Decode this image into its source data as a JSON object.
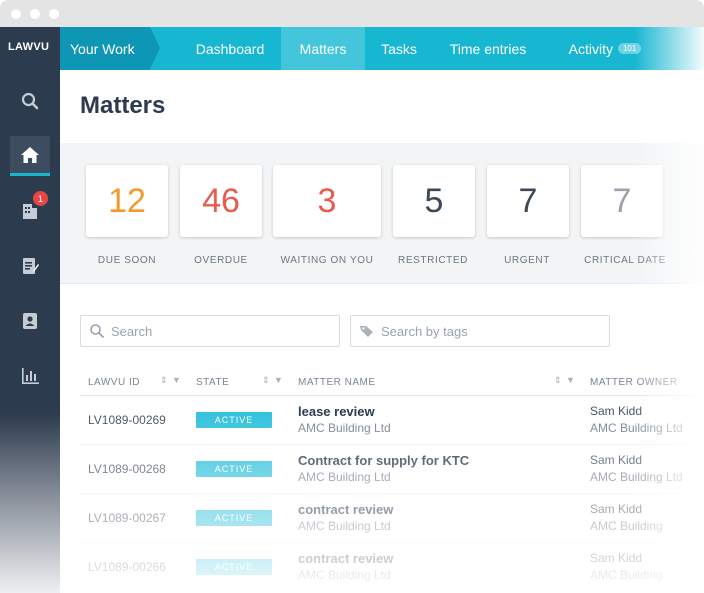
{
  "app": {
    "logo_text": "LAWVU"
  },
  "sidebar": {
    "items": [
      {
        "icon": "search-icon",
        "active": false
      },
      {
        "icon": "home-icon",
        "active": true
      },
      {
        "icon": "building-icon",
        "active": false,
        "badge": "1"
      },
      {
        "icon": "edit-document-icon",
        "active": false
      },
      {
        "icon": "contacts-icon",
        "active": false
      },
      {
        "icon": "bar-chart-icon",
        "active": false
      }
    ]
  },
  "nav": {
    "your_work": "Your Work",
    "tabs": [
      {
        "label": "Dashboard",
        "active": false
      },
      {
        "label": "Matters",
        "active": true
      },
      {
        "label": "Tasks",
        "active": false
      },
      {
        "label": "Time entries",
        "active": false
      },
      {
        "label": "Activity",
        "active": false,
        "count": "101"
      }
    ]
  },
  "page": {
    "title": "Matters"
  },
  "stats": [
    {
      "value": "12",
      "label": "DUE SOON",
      "color": "#f39a2b"
    },
    {
      "value": "46",
      "label": "OVERDUE",
      "color": "#e85b4d"
    },
    {
      "value": "3",
      "label": "WAITING ON YOU",
      "color": "#e85b4d"
    },
    {
      "value": "5",
      "label": "RESTRICTED",
      "color": "#3d4856"
    },
    {
      "value": "7",
      "label": "URGENT",
      "color": "#3d4856"
    },
    {
      "value": "7",
      "label": "CRITICAL DATE",
      "color": "#9aa3ad"
    }
  ],
  "search": {
    "placeholder": "Search",
    "tags_placeholder": "Search by tags"
  },
  "table": {
    "columns": [
      "LAWVU ID",
      "STATE",
      "MATTER NAME",
      "MATTER OWNER"
    ],
    "rows": [
      {
        "id": "LV1089-00269",
        "state": "ACTIVE",
        "name": "lease review",
        "company": "AMC Building Ltd",
        "owner": "Sam Kidd",
        "owner_company": "AMC Building Ltd"
      },
      {
        "id": "LV1089-00268",
        "state": "ACTIVE",
        "name": "Contract for supply for KTC",
        "company": "AMC Building Ltd",
        "owner": "Sam Kidd",
        "owner_company": "AMC Building Ltd"
      },
      {
        "id": "LV1089-00267",
        "state": "ACTIVE",
        "name": "contract review",
        "company": "AMC Building Ltd",
        "owner": "Sam Kidd",
        "owner_company": "AMC Building"
      },
      {
        "id": "LV1089-00266",
        "state": "ACTIVE",
        "name": "contract review",
        "company": "AMC Building Ltd",
        "owner": "Sam Kidd",
        "owner_company": "AMC Building"
      }
    ]
  },
  "colors": {
    "accent": "#17b6d1",
    "sidebar": "#2d3b4e",
    "active_badge": "#33c2dc"
  }
}
